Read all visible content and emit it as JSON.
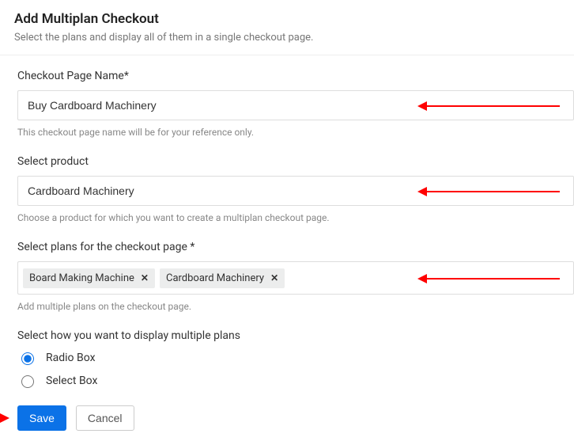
{
  "header": {
    "title": "Add Multiplan Checkout",
    "subtitle": "Select the plans and display all of them in a single checkout page."
  },
  "checkoutName": {
    "label": "Checkout Page Name*",
    "value": "Buy Cardboard Machinery",
    "help": "This checkout page name will be for your reference only."
  },
  "product": {
    "label": "Select product",
    "value": "Cardboard Machinery",
    "help": "Choose a product for which you want to create a multiplan checkout page."
  },
  "plans": {
    "label": "Select plans for the checkout page *",
    "tags": [
      {
        "label": "Board Making Machine"
      },
      {
        "label": "Cardboard Machinery"
      }
    ],
    "help": "Add multiple plans on the checkout page."
  },
  "display": {
    "label": "Select how you want to display multiple plans",
    "radio_label": "Radio Box",
    "select_label": "Select Box"
  },
  "actions": {
    "save": "Save",
    "cancel": "Cancel"
  }
}
